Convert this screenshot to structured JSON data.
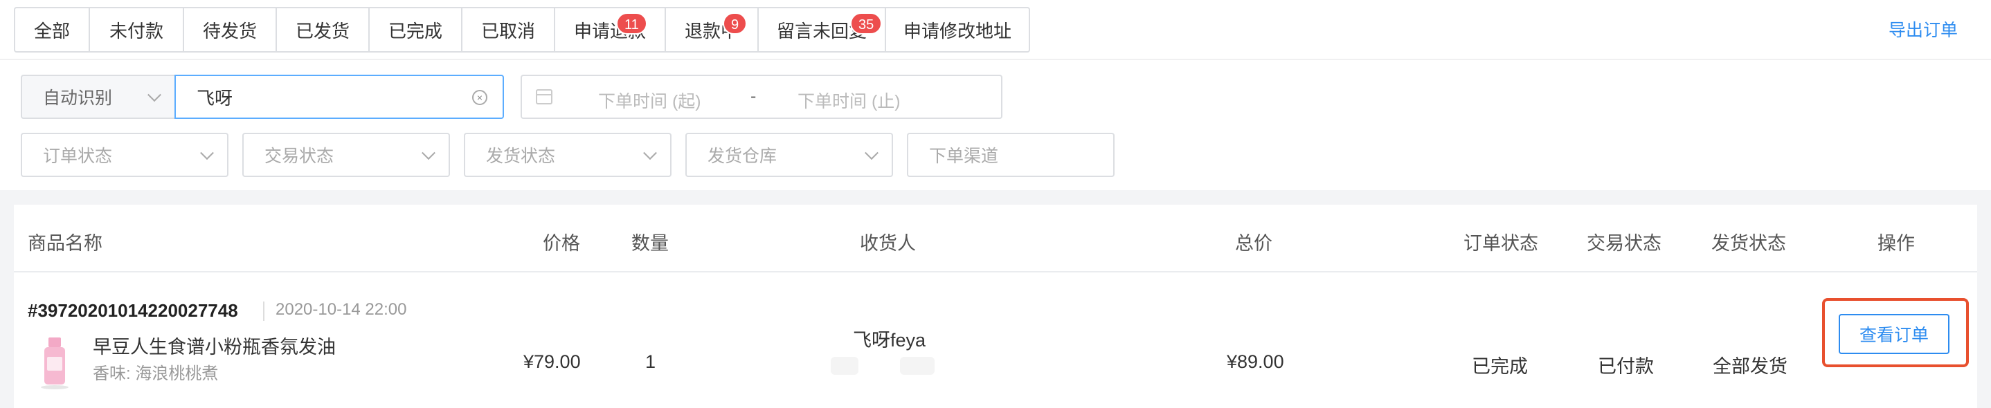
{
  "tabs": [
    {
      "label": "全部",
      "badge": null
    },
    {
      "label": "未付款",
      "badge": null
    },
    {
      "label": "待发货",
      "badge": null
    },
    {
      "label": "已发货",
      "badge": null
    },
    {
      "label": "已完成",
      "badge": null
    },
    {
      "label": "已取消",
      "badge": null
    },
    {
      "label": "申请退款",
      "badge": "11"
    },
    {
      "label": "退款中",
      "badge": "9"
    },
    {
      "label": "留言未回复",
      "badge": "35"
    },
    {
      "label": "申请修改地址",
      "badge": null
    }
  ],
  "export_label": "导出订单",
  "filters": {
    "mode_select": "自动识别",
    "search_value": "飞呀",
    "date_start_placeholder": "下单时间 (起)",
    "date_separator": "-",
    "date_end_placeholder": "下单时间 (止)",
    "order_status_placeholder": "订单状态",
    "trade_status_placeholder": "交易状态",
    "ship_status_placeholder": "发货状态",
    "warehouse_placeholder": "发货仓库",
    "channel_placeholder": "下单渠道"
  },
  "table": {
    "headers": {
      "product": "商品名称",
      "price": "价格",
      "qty": "数量",
      "receiver": "收货人",
      "total": "总价",
      "order_status": "订单状态",
      "trade_status": "交易状态",
      "ship_status": "发货状态",
      "actions": "操作"
    },
    "orders": [
      {
        "order_no": "#397202010142200277 48",
        "order_no_display": "#39720201014220027748",
        "time": "2020-10-14 22:00",
        "product_name": "早豆人生食谱小粉瓶香氛发油",
        "product_spec": "香味: 海浪桃桃煮",
        "price": "¥79.00",
        "qty": "1",
        "receiver": "飞呀feya",
        "total": "¥89.00",
        "order_status": "已完成",
        "trade_status": "已付款",
        "ship_status": "全部发货",
        "action_label": "查看订单"
      }
    ]
  },
  "colors": {
    "accent": "#2d8cf0",
    "badge": "#ed4d4d",
    "highlight": "#e8502e"
  }
}
